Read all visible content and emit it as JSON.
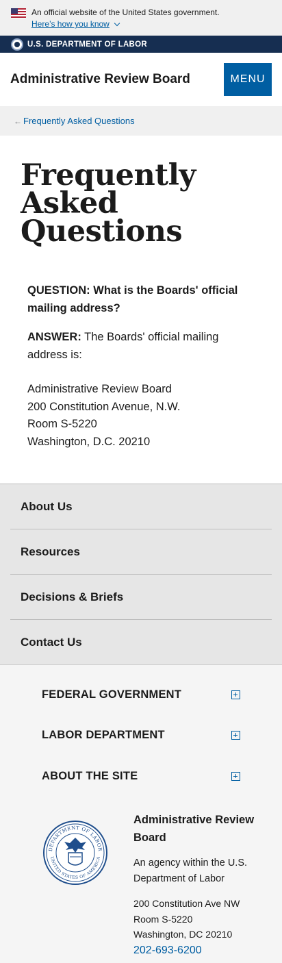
{
  "gov_banner": {
    "official_text": "An official website of the United States government.",
    "how_link": "Here’s how you know"
  },
  "dol_bar": {
    "text": "U.S. DEPARTMENT OF LABOR"
  },
  "header": {
    "title": "Administrative Review Board",
    "menu_label": "MENU"
  },
  "breadcrumb": {
    "link": "Frequently Asked Questions"
  },
  "main": {
    "title": "Frequently Asked Questions",
    "question": "QUESTION: What is the Boards' official mailing address?",
    "answer_label": "ANSWER:",
    "answer_text": " The Boards' official mailing address is:",
    "address_lines": [
      "Administrative Review Board",
      "200 Constitution Avenue, N.W.",
      "Room S-5220",
      "Washington, D.C. 20210"
    ]
  },
  "footer_nav": {
    "items": [
      {
        "label": "About Us"
      },
      {
        "label": "Resources"
      },
      {
        "label": "Decisions & Briefs"
      },
      {
        "label": "Contact Us"
      }
    ]
  },
  "footer_accordions": {
    "items": [
      {
        "label": "FEDERAL GOVERNMENT",
        "icon": "plus-square-icon"
      },
      {
        "label": "LABOR DEPARTMENT",
        "icon": "plus-square-icon"
      },
      {
        "label": "ABOUT THE SITE",
        "icon": "plus-square-icon"
      }
    ]
  },
  "agency": {
    "name": "Administrative Review Board",
    "description": "An agency within the U.S. Department of Labor",
    "address_lines": [
      "200 Constitution Ave NW",
      "Room S-5220",
      "Washington, DC 20210"
    ],
    "phone": "202-693-6200",
    "seal_text_top": "DEPARTMENT OF LABOR",
    "seal_text_bottom": "UNITED STATES OF AMERICA"
  },
  "colors": {
    "primary_blue": "#005ea2",
    "navy": "#162e51",
    "banner_gray": "#f0f0f0",
    "nav_gray": "#e6e6e6"
  }
}
